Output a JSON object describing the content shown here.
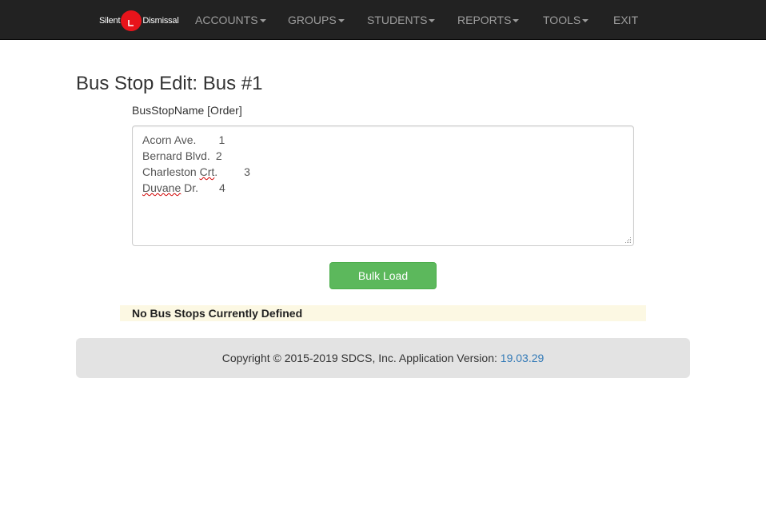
{
  "navbar": {
    "brand": {
      "left_text": "Silent",
      "right_text": "Dismissal"
    },
    "items": [
      {
        "label": "ACCOUNTS",
        "dropdown": true
      },
      {
        "label": "GROUPS",
        "dropdown": true
      },
      {
        "label": "STUDENTS",
        "dropdown": true
      },
      {
        "label": "REPORTS",
        "dropdown": true
      },
      {
        "label": "TOOLS",
        "dropdown": true
      },
      {
        "label": "EXIT",
        "dropdown": false
      }
    ]
  },
  "page": {
    "title": "Bus Stop Edit: Bus #1",
    "field_label": "BusStopName [Order]",
    "textarea_lines": [
      {
        "name": "Acorn Ave.",
        "order": "1"
      },
      {
        "name": "Bernard Blvd.",
        "order": "2"
      },
      {
        "name": "Charleston Crt.",
        "order": "3"
      },
      {
        "name": "Duvane Dr.",
        "order": "4"
      }
    ],
    "bulk_load_label": "Bulk Load",
    "notice": "No Bus Stops Currently Defined"
  },
  "footer": {
    "copyright": "Copyright © 2015-2019 SDCS, Inc. Application Version:",
    "version": "19.03.29"
  },
  "colors": {
    "navbar_bg": "#222222",
    "nav_text": "#9d9d9d",
    "brand_red": "#e8141b",
    "button_green": "#5cb85c",
    "notice_bg": "#fcf8e3",
    "footer_bg": "#e3e3e3",
    "link_blue": "#337ab7"
  }
}
